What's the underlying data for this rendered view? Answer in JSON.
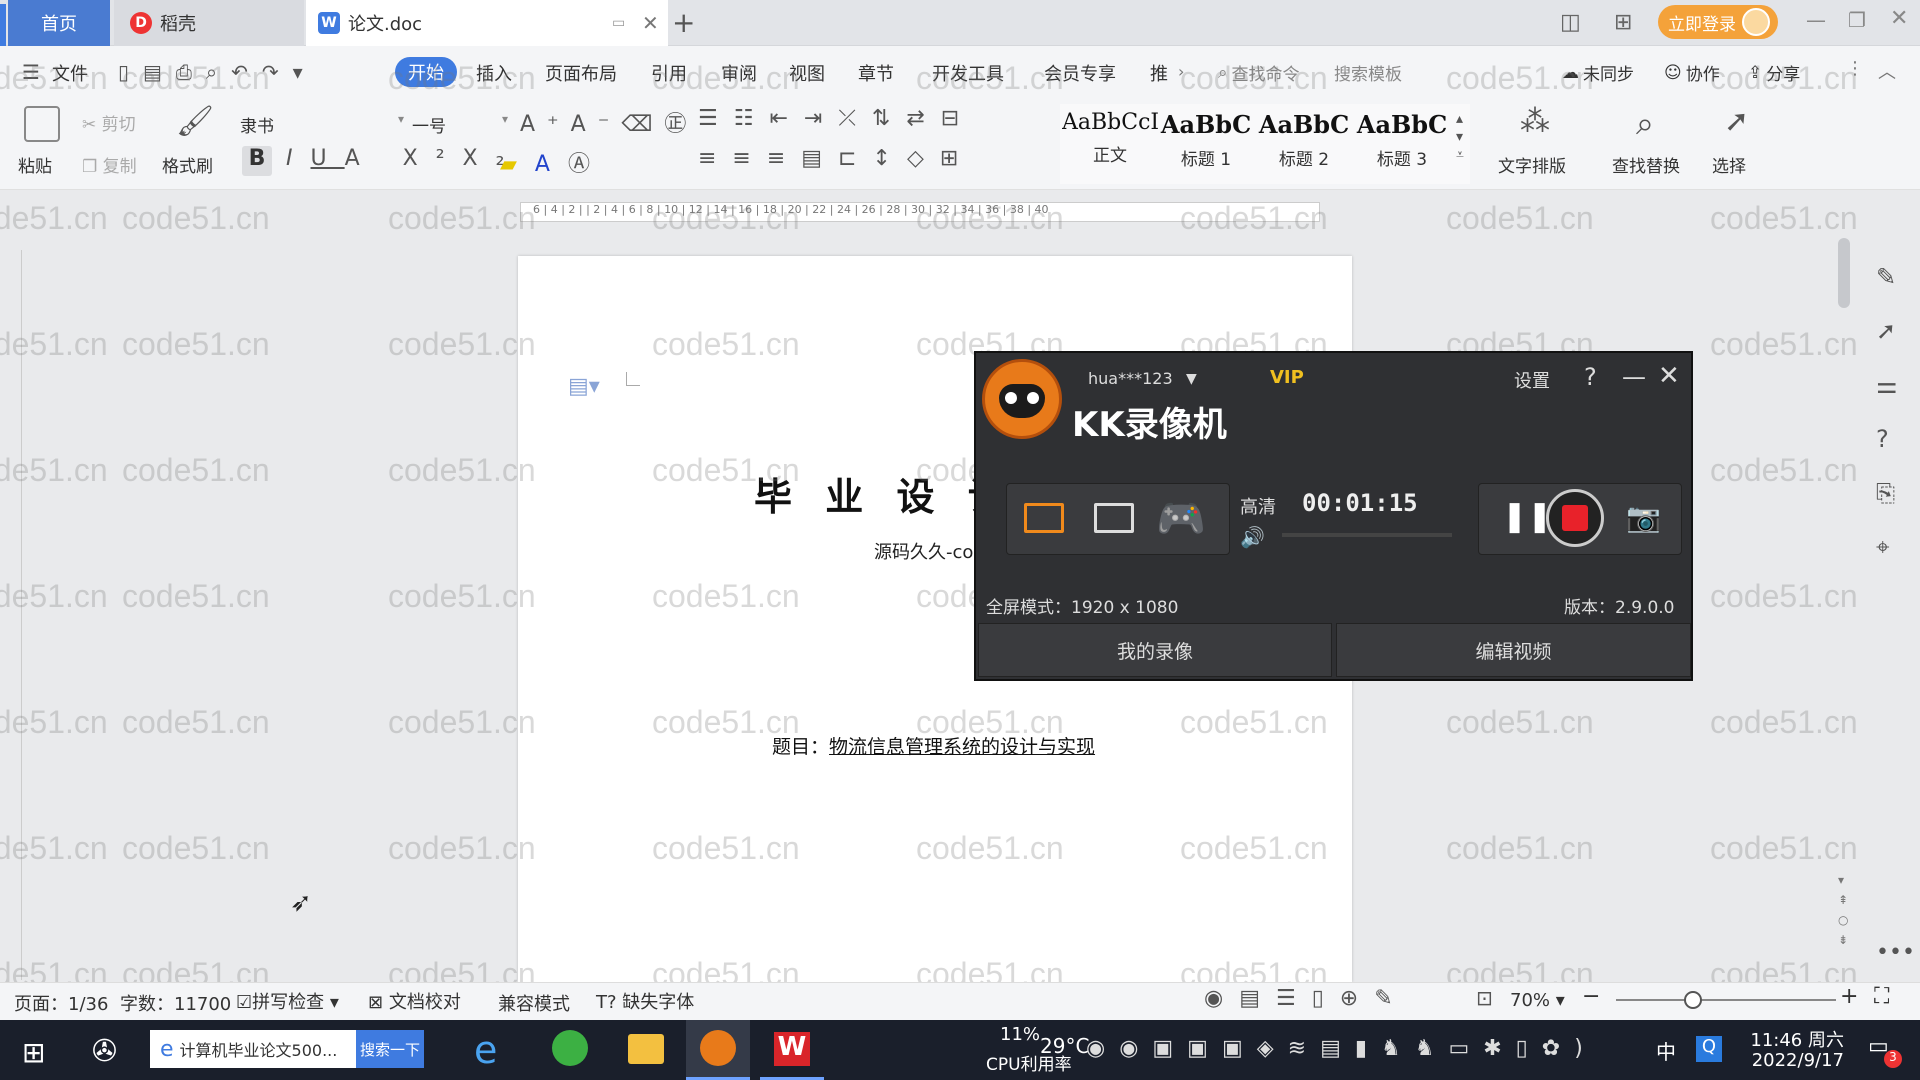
{
  "tabs": {
    "home": "首页",
    "daoke": "稻壳",
    "doc": "论文.doc",
    "new_tab": "+",
    "login": "立即登录"
  },
  "menus": [
    "文件",
    "开始",
    "插入",
    "页面布局",
    "引用",
    "审阅",
    "视图",
    "章节",
    "开发工具",
    "会员专享",
    "推"
  ],
  "search": {
    "cmd": "查找命令",
    "template": "搜索模板"
  },
  "right_menu": {
    "sync": "未同步",
    "collab": "协作",
    "share": "分享"
  },
  "ribbon": {
    "paste": "粘贴",
    "cut": "剪切",
    "copy": "复制",
    "format_painter": "格式刷",
    "font": "隶书",
    "size": "一号",
    "styles": [
      {
        "preview": "AaBbCcI",
        "label": "正文"
      },
      {
        "preview": "AaBbC",
        "label": "标题 1"
      },
      {
        "preview": "AaBbC",
        "label": "标题 2"
      },
      {
        "preview": "AaBbC",
        "label": "标题 3"
      }
    ],
    "text_layout": "文字排版",
    "find_replace": "查找替换",
    "select": "选择"
  },
  "ruler_numbers": "6 | 4 | 2 | | 2 | 4 | 6 | 8 | 10 | 12 | 14 | 16 | 18 | 20 | 22 | 24 | 26 | 28 | 30 | 32 | 34 | 36 | 38 | 40",
  "document": {
    "title": "毕 业 设 计",
    "subtitle": "源码久久-code99.top",
    "topic_label": "题目：",
    "topic": "物流信息管理系统的设计与实现"
  },
  "watermark": "code51.cn",
  "recorder": {
    "user": "hua***123",
    "vip": "VIP",
    "settings": "设置",
    "help": "?",
    "app_name": "KK录像机",
    "quality": "高清",
    "time": "00:01:15",
    "mode": "全屏模式：1920 x 1080",
    "version": "版本：2.9.0.0",
    "my_records": "我的录像",
    "edit_video": "编辑视频"
  },
  "status": {
    "page": "页面：1/36",
    "words": "字数：11700",
    "spell": "拼写检查",
    "proof": "文档校对",
    "compat": "兼容模式",
    "missing_font": "缺失字体",
    "zoom": "70%"
  },
  "taskbar": {
    "search_text": "计算机毕业论文500...",
    "search_btn": "搜索一下",
    "cpu": "11%",
    "cpu_label": "CPU利用率",
    "temp": "29°C",
    "ime": "中",
    "time": "11:46 周六",
    "date": "2022/9/17",
    "badge": "3"
  },
  "colors": {
    "accent": "#3f7be0",
    "login": "#f4a23a",
    "record_red": "#e8222a",
    "vip": "#f0c020"
  }
}
